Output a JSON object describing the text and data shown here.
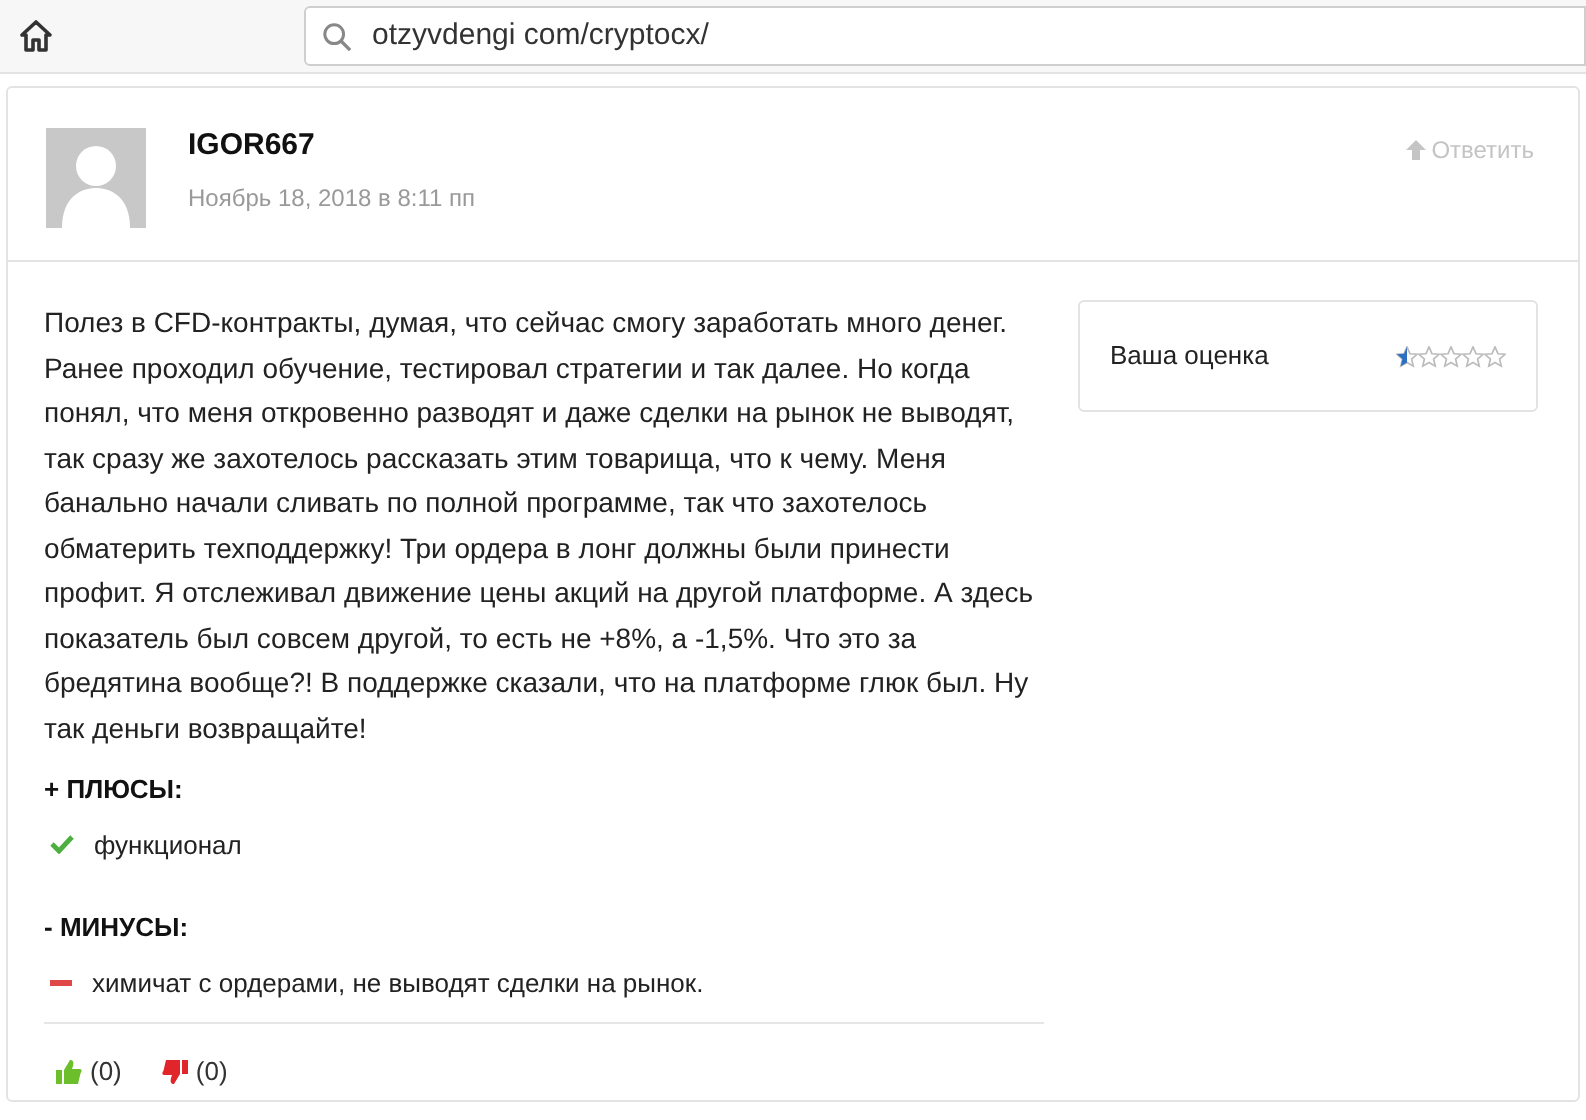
{
  "address_bar": {
    "value": "otzyvdengi com/cryptocx/"
  },
  "review": {
    "author": "IGOR667",
    "date": "Ноябрь 18, 2018 в 8:11 пп",
    "reply": "Ответить",
    "text": "Полез в CFD-контракты, думая, что сейчас смогу заработать много денег. Ранее проходил обучение, тестировал стратегии и так далее. Но когда понял, что меня откровенно разводят и даже сделки на рынок не выводят, так сразу же захотелось рассказать этим товарища, что к чему. Меня банально начали сливать по полной программе, так что захотелось обматерить техподдержку! Три ордера в лонг должны были принести профит. Я отслеживал движение цены акций на другой платформе. А здесь показатель был совсем другой, то есть не +8%, а -1,5%. Что это за бредятина вообще?! В поддержке сказали, что на платформе глюк был. Ну так деньги возвращайте!",
    "rating": {
      "label": "Ваша оценка",
      "stars": 0.5
    },
    "sections": [
      {
        "kind": "pros",
        "heading": "+ ПЛЮСЫ:",
        "items": [
          "функционал"
        ]
      },
      {
        "kind": "cons",
        "heading": "- МИНУСЫ:",
        "items": [
          "химичат с ордерами, не выводят сделки на рынок."
        ]
      }
    ],
    "votes": [
      {
        "kind": "up",
        "count": "(0)"
      },
      {
        "kind": "down",
        "count": "(0)"
      }
    ]
  }
}
